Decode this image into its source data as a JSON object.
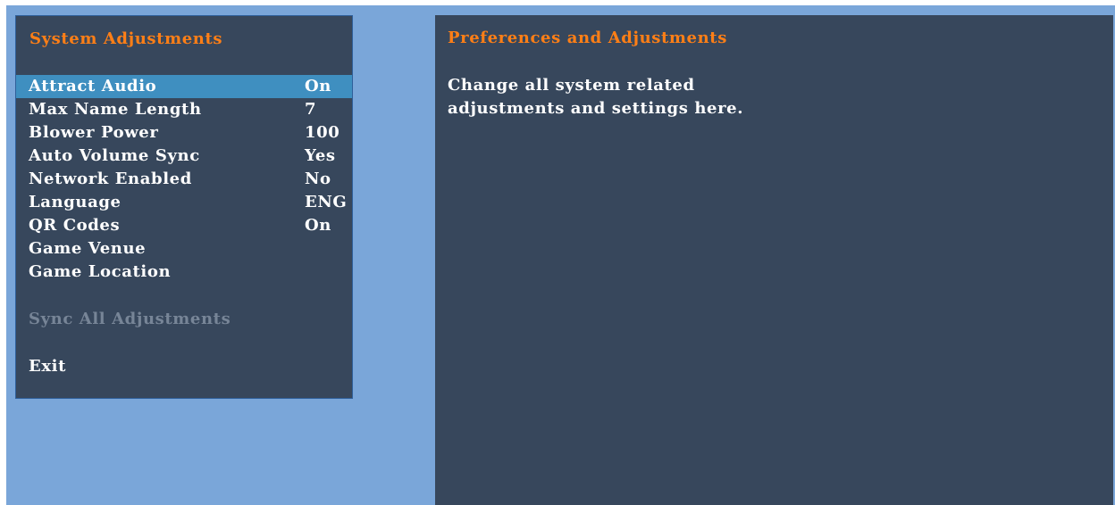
{
  "left_panel": {
    "title": "System Adjustments",
    "items": [
      {
        "label": "Attract Audio",
        "value": "On"
      },
      {
        "label": "Max Name Length",
        "value": "7"
      },
      {
        "label": "Blower Power",
        "value": "100"
      },
      {
        "label": "Auto Volume Sync",
        "value": "Yes"
      },
      {
        "label": "Network Enabled",
        "value": "No"
      },
      {
        "label": "Language",
        "value": "ENG"
      },
      {
        "label": "QR Codes",
        "value": "On"
      },
      {
        "label": "Game Venue",
        "value": ""
      },
      {
        "label": "Game Location",
        "value": ""
      }
    ],
    "sync_all_label": "Sync All Adjustments",
    "exit_label": "Exit",
    "selected_item": "Attract Audio"
  },
  "right_panel": {
    "title": "Preferences and Adjustments",
    "description_lines": [
      "Change all system related",
      "adjustments and settings here."
    ]
  },
  "colors": {
    "outer_background": "#7aa6d9",
    "panel_background": "#37475c",
    "title_accent": "#ff7f16",
    "selection_highlight": "#3f8fc0",
    "disabled_text": "#778597"
  }
}
